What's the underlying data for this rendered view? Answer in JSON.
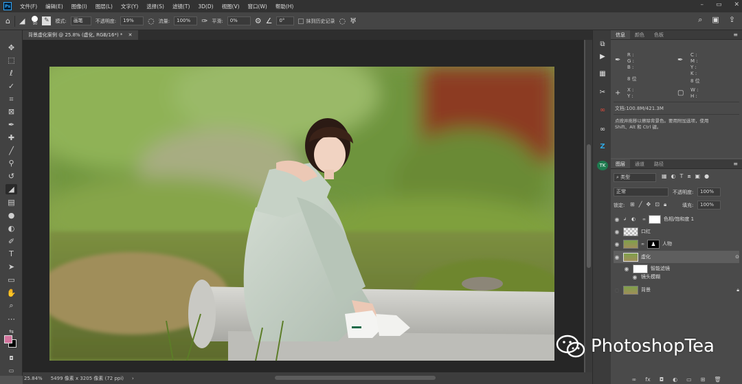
{
  "menu": {
    "app_icon": "Ps",
    "items": [
      "文件(F)",
      "编辑(E)",
      "图像(I)",
      "图层(L)",
      "文字(Y)",
      "选择(S)",
      "滤镜(T)",
      "3D(D)",
      "视图(V)",
      "窗口(W)",
      "帮助(H)"
    ]
  },
  "options": {
    "brush_size": "90",
    "mode_label": "模式:",
    "mode_value": "画笔",
    "opacity_label": "不透明度:",
    "opacity_value": "19%",
    "flow_label": "流量:",
    "flow_value": "100%",
    "smoothing_label": "平滑:",
    "smoothing_value": "0%",
    "angle_value": "0°",
    "erase_history_label": "抹到历史记录"
  },
  "document": {
    "tab_title": "背景虚化案例 @ 25.8% (虚化, RGB/16*) *",
    "zoom": "25.84%",
    "doc_info": "5499 像素 x 3205 像素 (72 ppi)"
  },
  "info_panel": {
    "tabs": [
      "信息",
      "颜色",
      "色板"
    ],
    "rgb_labels": "R :\nG :\nB :",
    "cmyk_labels": "C :\nM :\nY :\nK :",
    "bit_left": "8 位",
    "bit_right": "8 位",
    "xy_labels": "X :\nY :",
    "wh_labels": "W :\nH :",
    "doc_size": "文档:100.8M/421.3M",
    "hint": "点按并拖移以擦除背景色。要用附加选项，使用\nShift、Alt 和 Ctrl 键。"
  },
  "layers_panel": {
    "tabs": [
      "图层",
      "通道",
      "路径"
    ],
    "filter_label": "类型",
    "blend_mode": "正常",
    "opacity_label": "不透明度:",
    "opacity_value": "100%",
    "lock_label": "锁定:",
    "fill_label": "填充:",
    "fill_value": "100%",
    "layers": [
      {
        "name": "色相/饱和度 1"
      },
      {
        "name": "口红"
      },
      {
        "name": "人物"
      },
      {
        "name": "虚化"
      },
      {
        "name": "智能滤镜"
      },
      {
        "name": "镜头模糊"
      },
      {
        "name": "背景"
      }
    ]
  },
  "watermark": "PhotoshopTea",
  "colors": {
    "foreground": "#d4739d",
    "background": "#000000",
    "accent": "#31a8ff"
  }
}
